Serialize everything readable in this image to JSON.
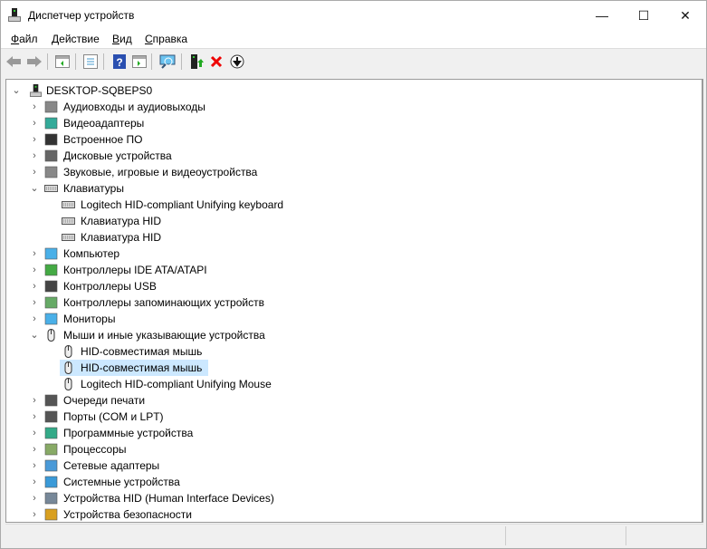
{
  "window": {
    "title": "Диспетчер устройств",
    "minimize": "—",
    "maximize": "☐",
    "close": "✕"
  },
  "menu": [
    {
      "label": "Файл",
      "accel": "Ф",
      "rest": "айл"
    },
    {
      "label": "Действие",
      "accel": "Д",
      "rest": "ействие"
    },
    {
      "label": "Вид",
      "accel": "В",
      "rest": "ид"
    },
    {
      "label": "Справка",
      "accel": "С",
      "rest": "правка"
    }
  ],
  "toolbar": [
    "back",
    "forward",
    "show-hide-console-tree",
    "properties",
    "help",
    "run-action",
    "scan-hardware",
    "update-driver",
    "uninstall",
    "disable"
  ],
  "tree": {
    "root": "DESKTOP-SQBEPS0",
    "items": [
      {
        "label": "Аудиовходы и аудиовыходы",
        "icon": "speaker-icon",
        "expanded": false
      },
      {
        "label": "Видеоадаптеры",
        "icon": "display-adapter-icon",
        "expanded": false
      },
      {
        "label": "Встроенное ПО",
        "icon": "firmware-icon",
        "expanded": false
      },
      {
        "label": "Дисковые устройства",
        "icon": "disk-icon",
        "expanded": false
      },
      {
        "label": "Звуковые, игровые и видеоустройства",
        "icon": "speaker-icon",
        "expanded": false
      },
      {
        "label": "Клавиатуры",
        "icon": "keyboard-icon",
        "expanded": true,
        "children": [
          "Logitech HID-compliant Unifying keyboard",
          "Клавиатура HID",
          "Клавиатура HID"
        ]
      },
      {
        "label": "Компьютер",
        "icon": "computer-icon",
        "expanded": false
      },
      {
        "label": "Контроллеры IDE ATA/ATAPI",
        "icon": "ide-controller-icon",
        "expanded": false
      },
      {
        "label": "Контроллеры USB",
        "icon": "usb-icon",
        "expanded": false
      },
      {
        "label": "Контроллеры запоминающих устройств",
        "icon": "storage-controller-icon",
        "expanded": false
      },
      {
        "label": "Мониторы",
        "icon": "monitor-icon",
        "expanded": false
      },
      {
        "label": "Мыши и иные указывающие устройства",
        "icon": "mouse-icon",
        "expanded": true,
        "children": [
          "HID-совместимая мышь",
          "HID-совместимая мышь",
          "Logitech HID-compliant Unifying Mouse"
        ],
        "selected_child": 1
      },
      {
        "label": "Очереди печати",
        "icon": "printer-icon",
        "expanded": false
      },
      {
        "label": "Порты (COM и LPT)",
        "icon": "port-icon",
        "expanded": false
      },
      {
        "label": "Программные устройства",
        "icon": "software-device-icon",
        "expanded": false
      },
      {
        "label": "Процессоры",
        "icon": "processor-icon",
        "expanded": false
      },
      {
        "label": "Сетевые адаптеры",
        "icon": "network-adapter-icon",
        "expanded": false
      },
      {
        "label": "Системные устройства",
        "icon": "system-device-icon",
        "expanded": false
      },
      {
        "label": "Устройства HID (Human Interface Devices)",
        "icon": "hid-icon",
        "expanded": false
      },
      {
        "label": "Устройства безопасности",
        "icon": "security-device-icon",
        "expanded": false
      }
    ]
  },
  "colors": {
    "selection": "#cce8ff"
  }
}
